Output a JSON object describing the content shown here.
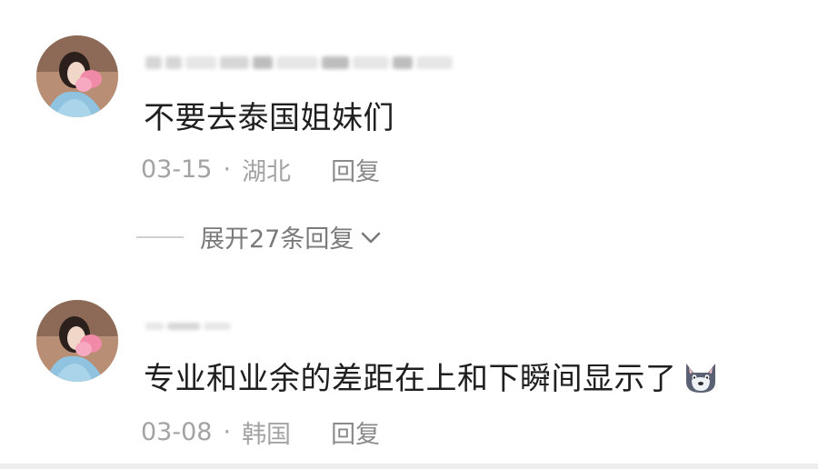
{
  "comments": [
    {
      "text": "不要去泰国姐妹们",
      "date": "03-15",
      "separator": "·",
      "location": "湖北",
      "reply_label": "回复",
      "expand_label": "展开27条回复"
    },
    {
      "text": "专业和业余的差距在上和下瞬间显示了",
      "date": "03-08",
      "separator": "·",
      "location": "韩国",
      "reply_label": "回复"
    }
  ],
  "icons": {
    "expand_chevron": "chevron-down-icon",
    "emoji": "wolf-face-emoji-icon"
  },
  "colors": {
    "text_primary": "#1f1f1f",
    "text_meta": "#a3a3a3",
    "text_reply": "#8a8a8a"
  }
}
